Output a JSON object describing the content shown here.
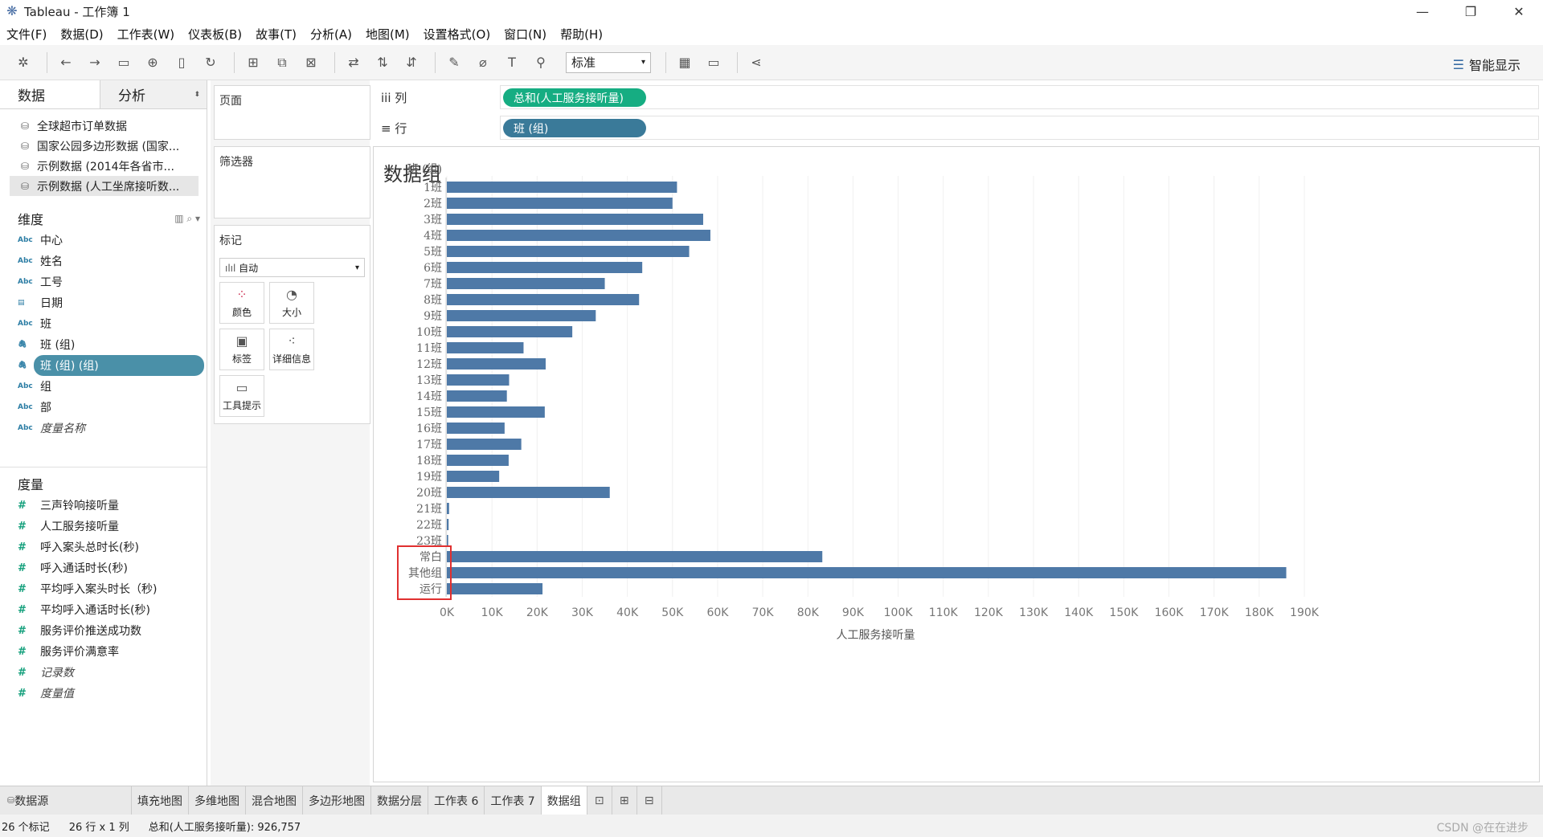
{
  "window": {
    "title": "Tableau - 工作簿 1",
    "minimize": "—",
    "restore": "❐",
    "close": "✕"
  },
  "menu": [
    "文件(F)",
    "数据(D)",
    "工作表(W)",
    "仪表板(B)",
    "故事(T)",
    "分析(A)",
    "地图(M)",
    "设置格式(O)",
    "窗口(N)",
    "帮助(H)"
  ],
  "toolbar": {
    "fit_select": "标准",
    "smart_show": "智能显示"
  },
  "datapane": {
    "tab_data": "数据",
    "tab_analysis": "分析",
    "datasources": [
      "全球超市订单数据",
      "国家公园多边形数据 (国家...",
      "示例数据 (2014年各省市...",
      "示例数据 (人工坐席接听数..."
    ],
    "dimensions_header": "维度",
    "dimensions": [
      {
        "type": "Abc",
        "label": "中心"
      },
      {
        "type": "Abc",
        "label": "姓名"
      },
      {
        "type": "Abc",
        "label": "工号"
      },
      {
        "type": "date",
        "label": "日期"
      },
      {
        "type": "Abc",
        "label": "班"
      },
      {
        "type": "group",
        "label": "班 (组)"
      },
      {
        "type": "group",
        "label": "班 (组) (组)"
      },
      {
        "type": "Abc",
        "label": "组"
      },
      {
        "type": "Abc",
        "label": "部"
      },
      {
        "type": "Abc",
        "label": "度量名称"
      }
    ],
    "measures_header": "度量",
    "measures": [
      "三声铃响接听量",
      "人工服务接听量",
      "呼入案头总时长(秒)",
      "呼入通话时长(秒)",
      "平均呼入案头时长（秒)",
      "平均呼入通话时长(秒)",
      "服务评价推送成功数",
      "服务评价满意率",
      "记录数",
      "度量值"
    ]
  },
  "shelves": {
    "pages": "页面",
    "filters": "筛选器",
    "marks": "标记",
    "marks_type": "自动",
    "mark_buttons": [
      "颜色",
      "大小",
      "标签",
      "详细信息",
      "工具提示"
    ],
    "columns_label": "iii 列",
    "rows_label": "≡ 行",
    "columns_pill": "总和(人工服务接听量)",
    "rows_pill": "班 (组)"
  },
  "view": {
    "title": "数据组"
  },
  "chart_data": {
    "type": "bar",
    "orientation": "horizontal",
    "ylabel": "班 (组)",
    "xlabel": "人工服务接听量",
    "categories": [
      "1班",
      "2班",
      "3班",
      "4班",
      "5班",
      "6班",
      "7班",
      "8班",
      "9班",
      "10班",
      "11班",
      "12班",
      "13班",
      "14班",
      "15班",
      "16班",
      "17班",
      "18班",
      "19班",
      "20班",
      "21班",
      "22班",
      "23班",
      "常白",
      "其他组",
      "运行"
    ],
    "values": [
      51000,
      50000,
      56800,
      58400,
      53700,
      43300,
      35000,
      42600,
      33000,
      27800,
      17000,
      21900,
      13800,
      13300,
      21700,
      12800,
      16500,
      13700,
      11600,
      36100,
      500,
      400,
      300,
      83200,
      186000,
      21200
    ],
    "xlim": [
      0,
      190000
    ],
    "xticks": [
      "0K",
      "10K",
      "20K",
      "30K",
      "40K",
      "50K",
      "60K",
      "70K",
      "80K",
      "90K",
      "100K",
      "110K",
      "120K",
      "130K",
      "140K",
      "150K",
      "160K",
      "170K",
      "180K",
      "190K"
    ],
    "bar_color": "#4e79a7",
    "highlight_box_color": "#e03030",
    "highlighted_categories": [
      "常白",
      "其他组",
      "运行"
    ]
  },
  "sheet_tabs": [
    "数据源",
    "填充地图",
    "多维地图",
    "混合地图",
    "多边形地图",
    "数据分层",
    "工作表 6",
    "工作表 7",
    "数据组"
  ],
  "active_sheet": "数据组",
  "status": {
    "marks": "26 个标记",
    "dims": "26 行 x 1 列",
    "sum": "总和(人工服务接听量): 926,757",
    "watermark": "CSDN @在在进步"
  }
}
